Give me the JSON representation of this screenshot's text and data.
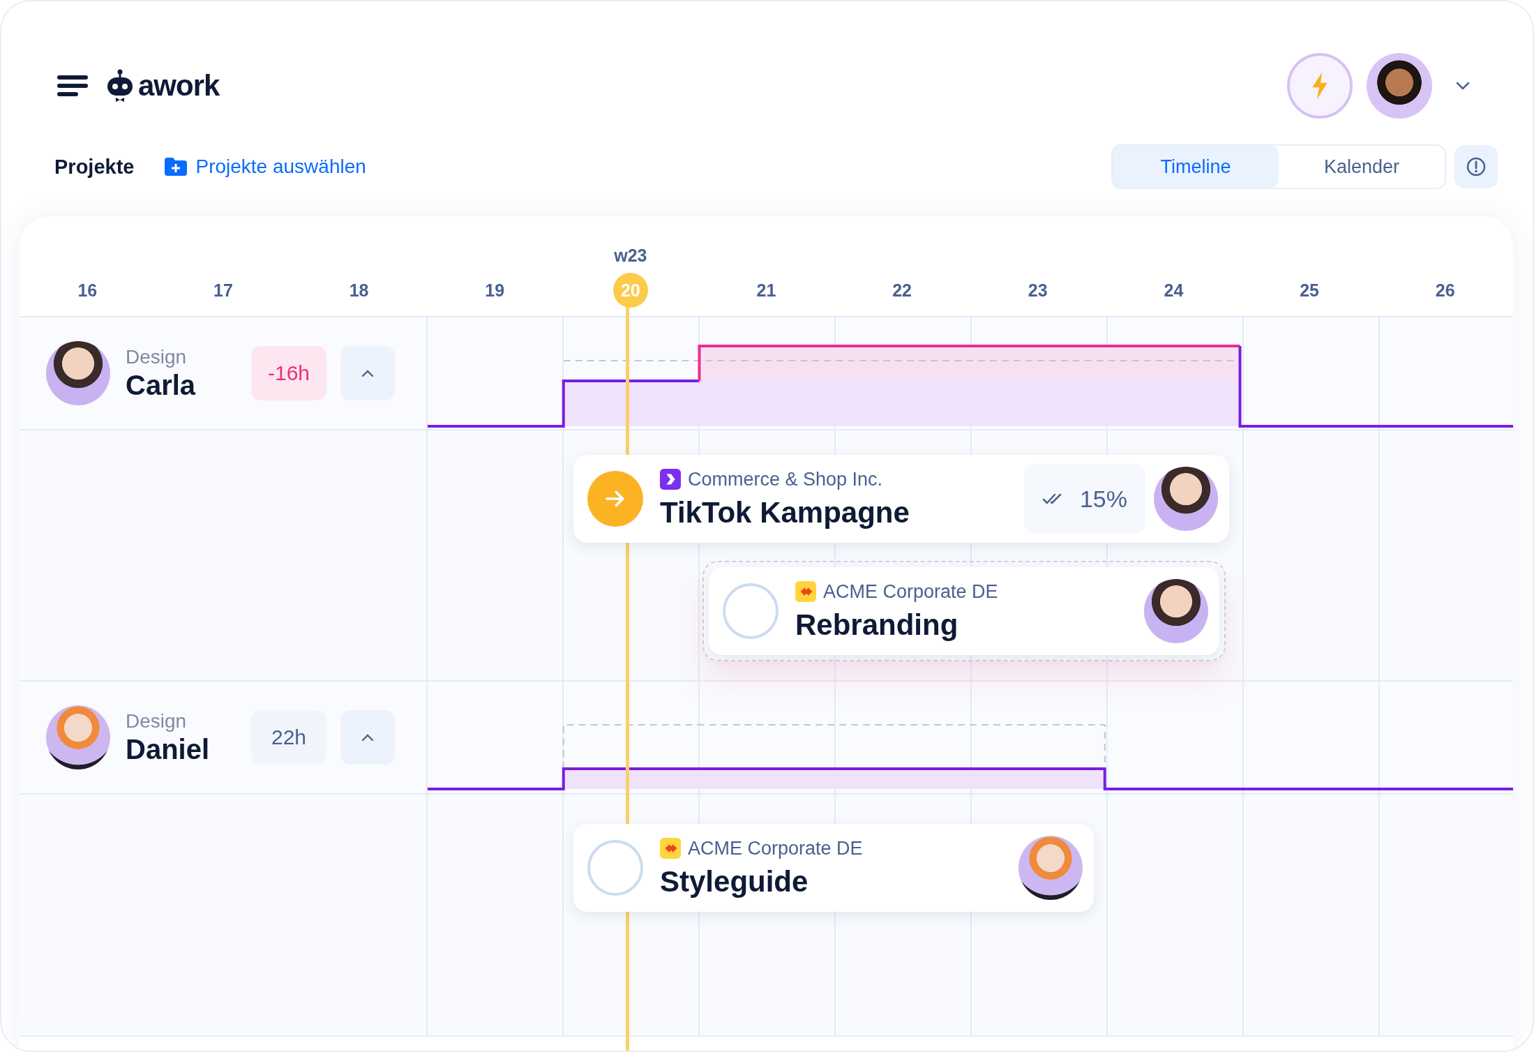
{
  "app": {
    "logo": "awork"
  },
  "header": {
    "projects_label": "Projekte",
    "select_projects": "Projekte auswählen",
    "view_tabs": [
      {
        "label": "Timeline",
        "selected": true
      },
      {
        "label": "Kalender",
        "selected": false
      }
    ]
  },
  "timeline": {
    "days": [
      {
        "label": "16",
        "today": false
      },
      {
        "label": "17",
        "today": false
      },
      {
        "label": "18",
        "today": false
      },
      {
        "label": "19",
        "today": false
      },
      {
        "label": "20",
        "today": true,
        "week": "w23"
      },
      {
        "label": "21",
        "today": false
      },
      {
        "label": "22",
        "today": false
      },
      {
        "label": "23",
        "today": false
      },
      {
        "label": "24",
        "today": false
      },
      {
        "label": "25",
        "today": false
      },
      {
        "label": "26",
        "today": false
      }
    ]
  },
  "people": [
    {
      "team": "Design",
      "name": "Carla",
      "hours": "-16h",
      "overbooked": true,
      "expanded": true,
      "tasks": [
        {
          "client": {
            "name": "Commerce & Shop Inc.",
            "kind": "shop"
          },
          "title": "TikTok Kampagne",
          "kind": "active",
          "progress": "15%",
          "dragging": false
        },
        {
          "client": {
            "name": "ACME Corporate DE",
            "kind": "acme"
          },
          "title": "Rebranding",
          "kind": "open",
          "dragging": true
        }
      ]
    },
    {
      "team": "Design",
      "name": "Daniel",
      "hours": "22h",
      "overbooked": false,
      "expanded": true,
      "tasks": [
        {
          "client": {
            "name": "ACME Corporate DE",
            "kind": "acme"
          },
          "title": "Styleguide",
          "kind": "open",
          "dragging": false
        }
      ]
    }
  ]
}
